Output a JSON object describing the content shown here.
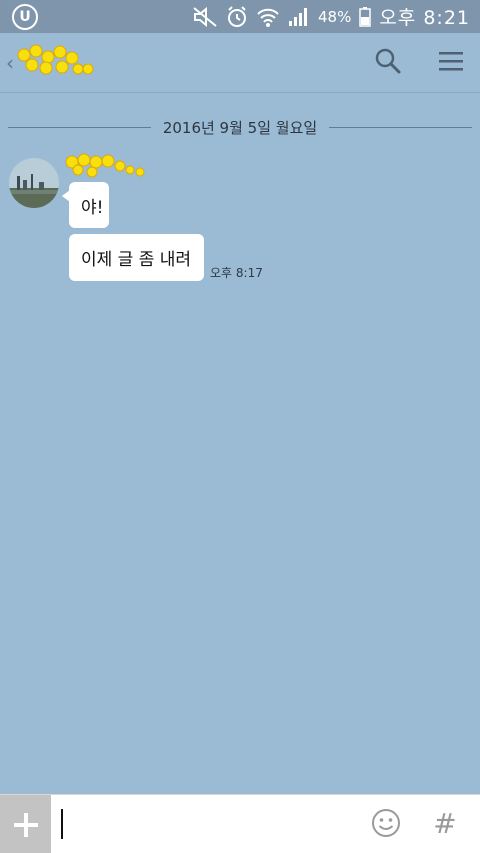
{
  "status_bar": {
    "carrier_label": "U",
    "battery_percent": "48%",
    "time_label": "오후 8:21",
    "icons": [
      "carrier-logo-icon",
      "mute-icon",
      "alarm-icon",
      "wifi-icon",
      "signal-icon",
      "battery-icon"
    ]
  },
  "header": {
    "icons": [
      "back-chevron-icon",
      "search-icon",
      "menu-icon"
    ]
  },
  "chat": {
    "date_divider": "2016년 9월 5일 월요일",
    "messages": [
      {
        "text": "야!"
      },
      {
        "text": "이제 글 좀 내려"
      }
    ],
    "last_time": "오후 8:17"
  },
  "input_bar": {
    "plus_label": "+",
    "hash_label": "#"
  },
  "colors": {
    "chat_background": "#9bbbd4",
    "status_bar": "#7f95ab",
    "bubble": "#ffffff",
    "plus_button": "#c3c3c3"
  }
}
